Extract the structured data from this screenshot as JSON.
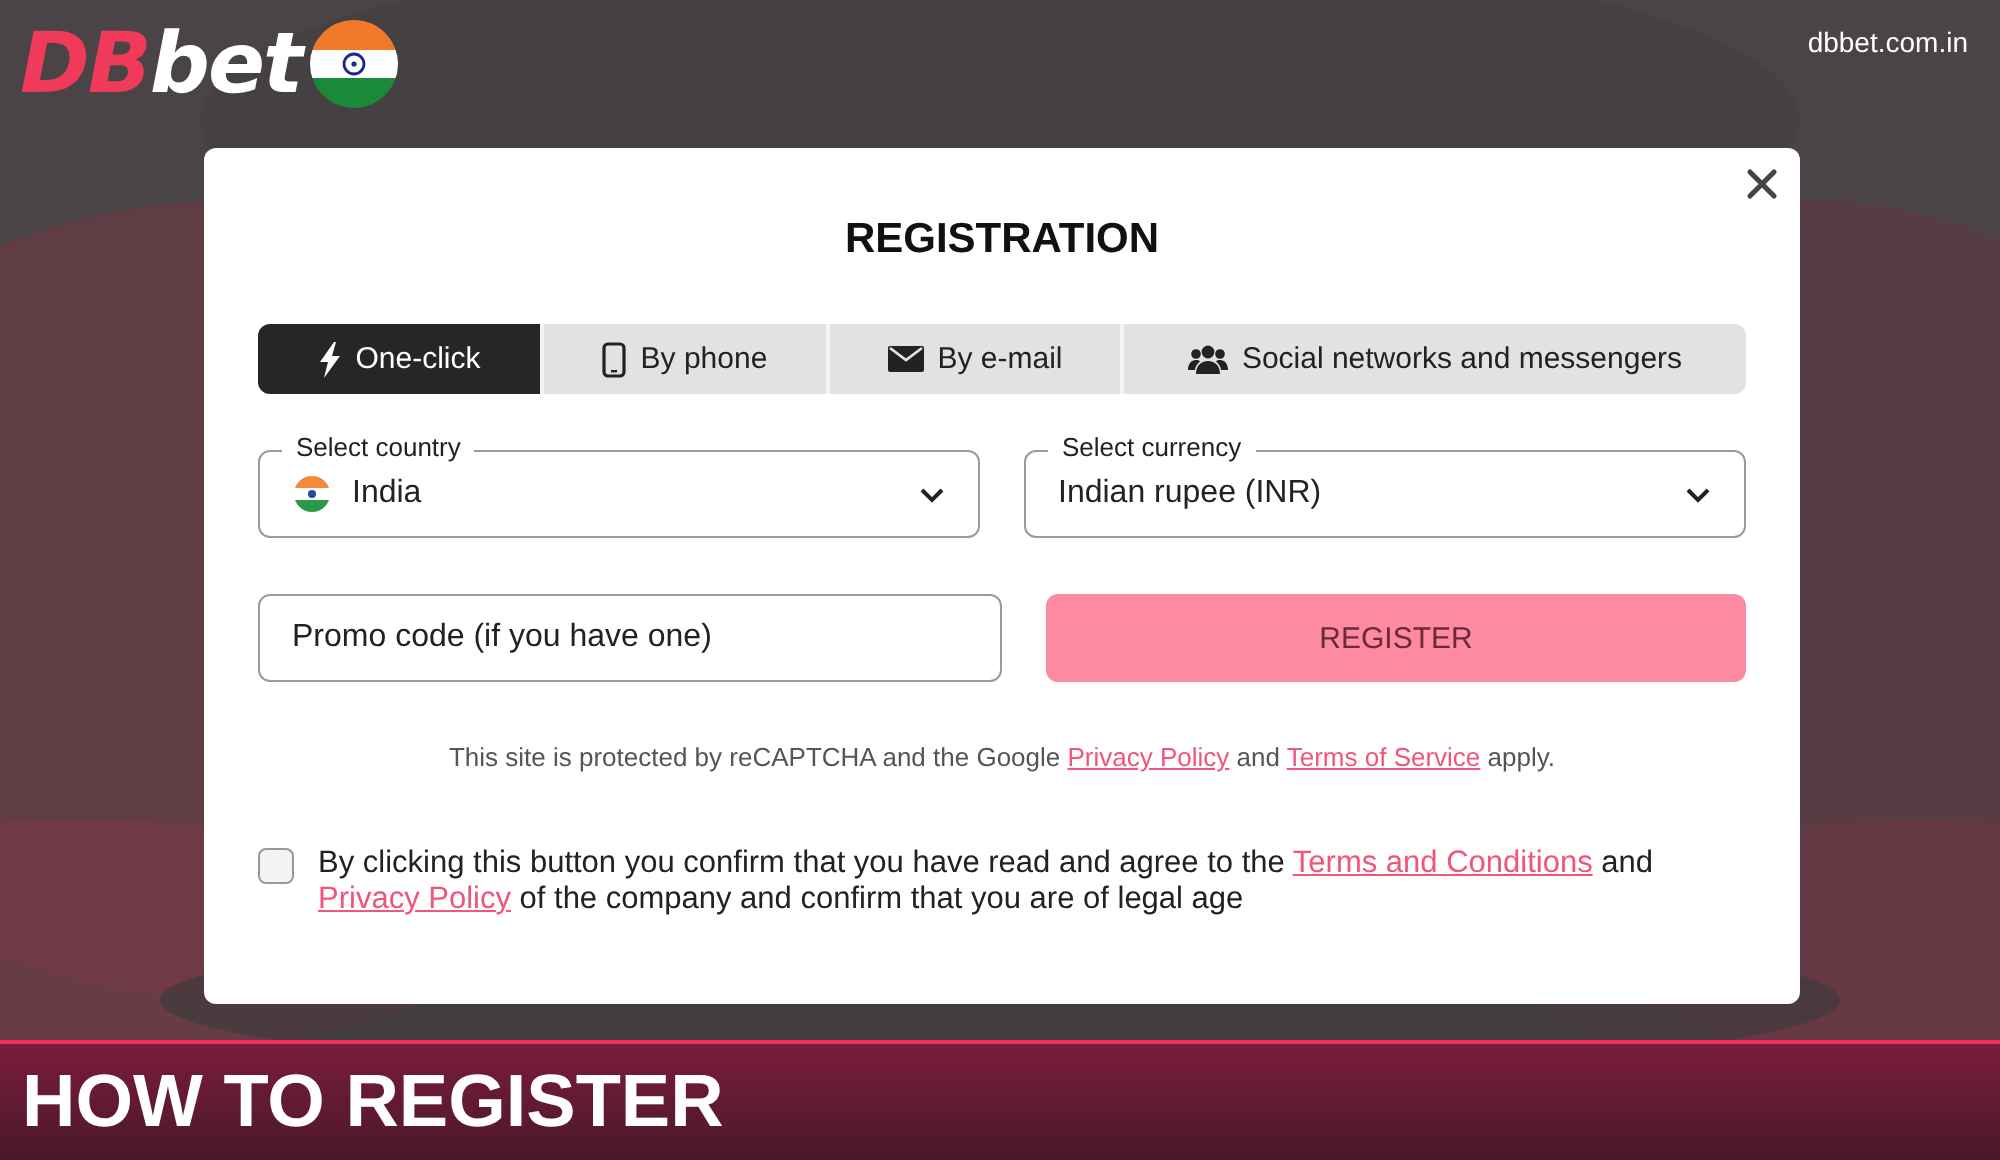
{
  "logo": {
    "prefix": "DB",
    "suffix": "bet"
  },
  "site_url": "dbbet.com.in",
  "dialog": {
    "title": "REGISTRATION",
    "tabs": [
      {
        "label": "One-click",
        "selected": true
      },
      {
        "label": "By phone",
        "selected": false
      },
      {
        "label": "By e-mail",
        "selected": false
      },
      {
        "label": "Social networks and messengers",
        "selected": false
      }
    ],
    "country": {
      "label": "Select country",
      "value": "India"
    },
    "currency": {
      "label": "Select currency",
      "value": "Indian rupee (INR)"
    },
    "promo": {
      "placeholder": "Promo code (if you have one)"
    },
    "register_button": "REGISTER",
    "recaptcha_note": [
      {
        "kind": "text",
        "text": "This site is protected by reCAPTCHA and the Google "
      },
      {
        "kind": "link",
        "text": "Privacy Policy"
      },
      {
        "kind": "text",
        "text": " and "
      },
      {
        "kind": "link",
        "text": "Terms of Service"
      },
      {
        "kind": "text",
        "text": " apply."
      }
    ],
    "agreement": {
      "checked": false,
      "parts": [
        {
          "kind": "text",
          "text": "By clicking this button you confirm that you have read and agree to the "
        },
        {
          "kind": "link",
          "text": "Terms and Conditions"
        },
        {
          "kind": "text",
          "text": " and "
        },
        {
          "kind": "link",
          "text": "Privacy Policy"
        },
        {
          "kind": "text",
          "text": " of the company and confirm that you are of legal age"
        }
      ]
    }
  },
  "banner_title": "HOW TO REGISTER"
}
